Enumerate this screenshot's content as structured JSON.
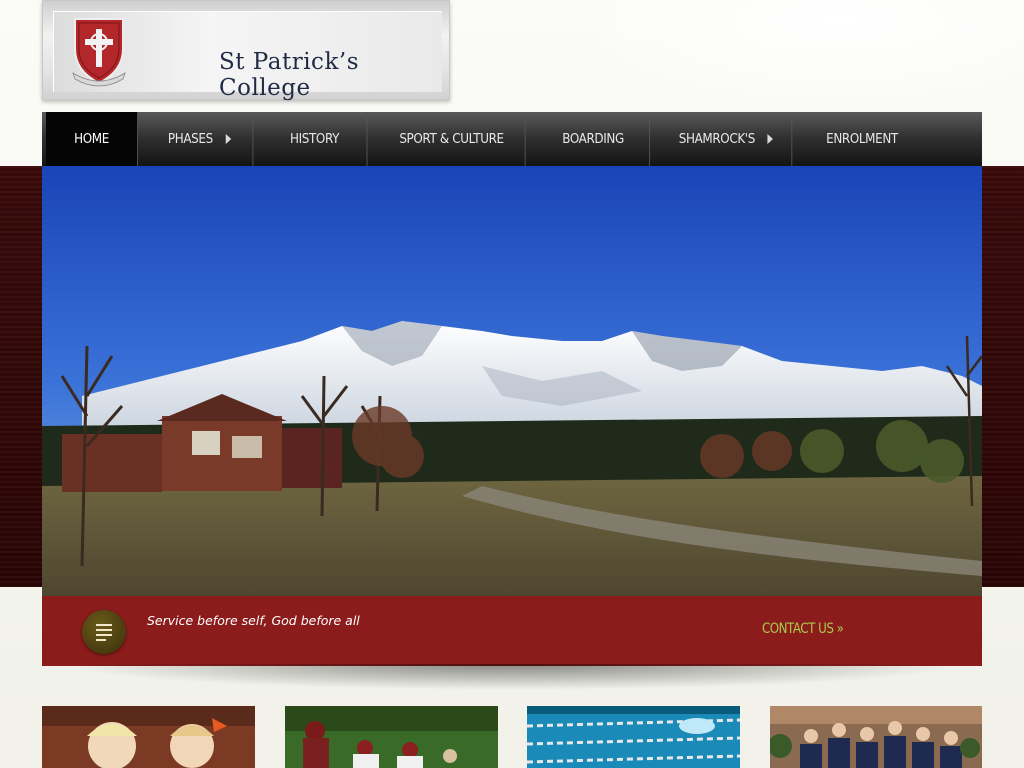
{
  "header": {
    "school_name": "St Patrick’s College",
    "crest_motto": "Service before self"
  },
  "nav": {
    "items": [
      {
        "label": "HOME",
        "active": true,
        "has_submenu": false
      },
      {
        "label": "PHASES",
        "active": false,
        "has_submenu": true
      },
      {
        "label": "HISTORY",
        "active": false,
        "has_submenu": false
      },
      {
        "label": "SPORT & CULTURE",
        "active": false,
        "has_submenu": false
      },
      {
        "label": "BOARDING",
        "active": false,
        "has_submenu": false
      },
      {
        "label": "SHAMROCK'S",
        "active": false,
        "has_submenu": true
      },
      {
        "label": "ENROLMENT",
        "active": false,
        "has_submenu": false
      }
    ]
  },
  "banner": {
    "tagline": "Service before self, God before all",
    "contact_label": "CONTACT US »",
    "icon": "text-lines-icon"
  },
  "colors": {
    "brand_red": "#8c1c1c",
    "contact_green": "#a8c94a",
    "nav_dark": "#141414"
  }
}
